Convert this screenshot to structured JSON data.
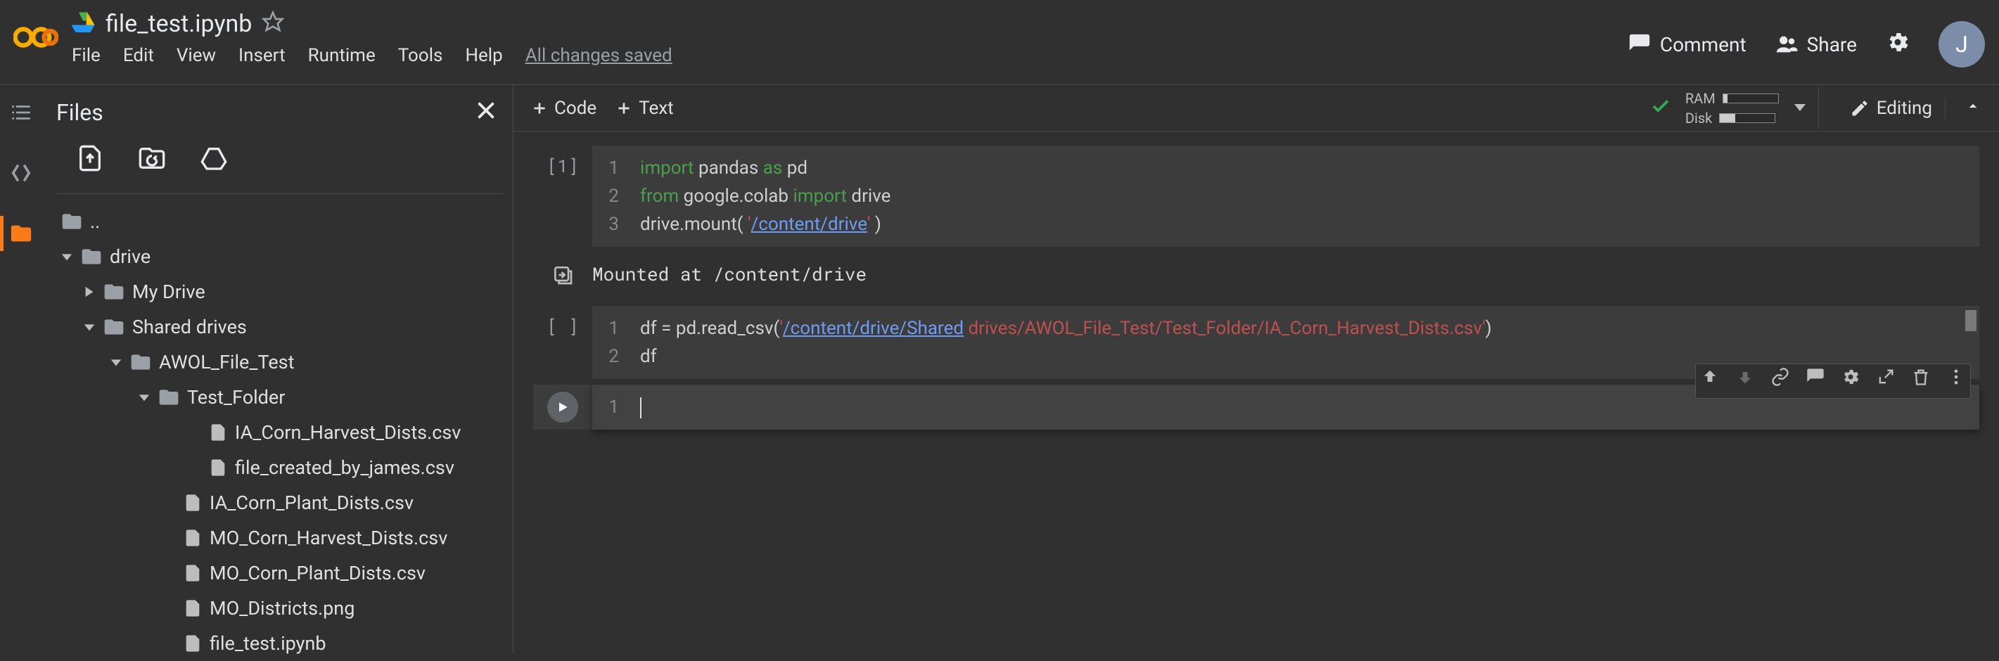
{
  "header": {
    "filename": "file_test.ipynb",
    "menus": [
      "File",
      "Edit",
      "View",
      "Insert",
      "Runtime",
      "Tools",
      "Help"
    ],
    "saved_status": "All changes saved",
    "comment": "Comment",
    "share": "Share",
    "avatar_initial": "J"
  },
  "toolbar": {
    "code": "Code",
    "text": "Text",
    "ram_label": "RAM",
    "disk_label": "Disk",
    "ram_pct": 8,
    "disk_pct": 28,
    "editing": "Editing"
  },
  "sidebar": {
    "title": "Files",
    "tree": {
      "up": "..",
      "drive": "drive",
      "mydrive": "My Drive",
      "shared": "Shared drives",
      "awol": "AWOL_File_Test",
      "testfolder": "Test_Folder",
      "f_harvest": "IA_Corn_Harvest_Dists.csv",
      "f_james": "file_created_by_james.csv",
      "f_plant": "IA_Corn_Plant_Dists.csv",
      "f_moharv": "MO_Corn_Harvest_Dists.csv",
      "f_moplant": "MO_Corn_Plant_Dists.csv",
      "f_png": "MO_Districts.png",
      "f_nb": "file_test.ipynb"
    }
  },
  "cells": {
    "c1_prompt": "[1]",
    "c1_l1_a": "import",
    "c1_l1_b": " pandas ",
    "c1_l1_c": "as",
    "c1_l1_d": " pd",
    "c1_l2_a": "from",
    "c1_l2_b": " google.colab ",
    "c1_l2_c": "import",
    "c1_l2_d": " drive",
    "c1_l3_a": "drive.mount( ",
    "c1_l3_b": "'",
    "c1_l3_c": "/content/drive",
    "c1_l3_d": "'",
    "c1_l3_e": " )",
    "c1_out": "Mounted at /content/drive",
    "c2_prompt": "[ ]",
    "c2_l1_a": "df = pd.read_csv(",
    "c2_l1_b": "'",
    "c2_l1_c": "/content/drive/Shared",
    "c2_l1_d": " drives/AWOL_File_Test/Test_Folder/IA_Corn_Harvest_Dists.csv'",
    "c2_l1_e": ")",
    "c2_l2": "df"
  }
}
